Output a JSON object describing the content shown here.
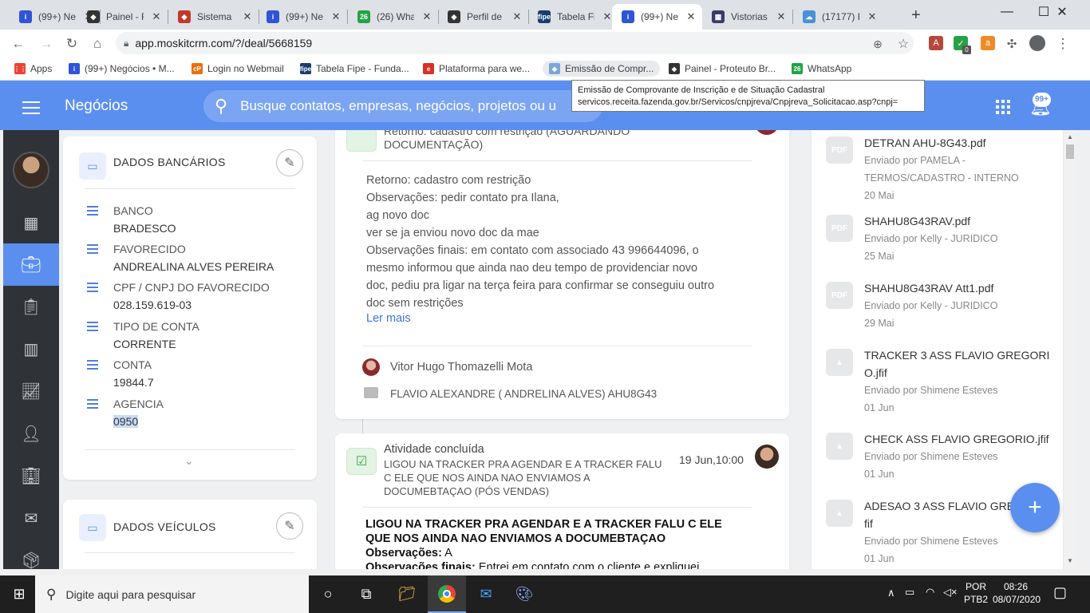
{
  "browser": {
    "tabs": [
      {
        "title": "(99+) Ne",
        "fav": "i",
        "color": "#2f54d6",
        "active": false
      },
      {
        "title": "Painel - F",
        "fav": "◆",
        "color": "#333333",
        "active": false
      },
      {
        "title": "Sistema |",
        "fav": "◆",
        "color": "#c0392b",
        "active": false
      },
      {
        "title": "(99+) Ne",
        "fav": "i",
        "color": "#2f54d6",
        "active": false
      },
      {
        "title": "(26) Wha",
        "fav": "26",
        "color": "#25a244",
        "active": false
      },
      {
        "title": "Perfil de",
        "fav": "◆",
        "color": "#333333",
        "active": false
      },
      {
        "title": "Tabela Fi",
        "fav": "fipe",
        "color": "#1b3b6f",
        "active": false
      },
      {
        "title": "(99+) Ne",
        "fav": "i",
        "color": "#2f54d6",
        "active": true
      },
      {
        "title": "Vistorias",
        "fav": "▦",
        "color": "#3a3a6a",
        "active": false
      },
      {
        "title": "(17177) F",
        "fav": "☁",
        "color": "#4a90d9",
        "active": false
      }
    ],
    "new_tab": "+",
    "url": "app.moskitcrm.com/?/deal/5668159",
    "bookmarks": [
      {
        "label": "Apps",
        "color": "#ea4335",
        "icon": "⋮⋮"
      },
      {
        "label": "(99+) Negócios • M...",
        "color": "#2f54d6",
        "icon": "i"
      },
      {
        "label": "Login no Webmail",
        "color": "#e8710a",
        "icon": "cP"
      },
      {
        "label": "Tabela Fipe - Funda...",
        "color": "#1b3b6f",
        "icon": "fipe"
      },
      {
        "label": "Plataforma para we...",
        "color": "#d93025",
        "icon": "e"
      },
      {
        "label": "Emissão de Compr...",
        "color": "#7aa7d8",
        "icon": "◆"
      },
      {
        "label": "Painel - Proteuto Br...",
        "color": "#333333",
        "icon": "◆"
      },
      {
        "label": "WhatsApp",
        "color": "#25a244",
        "icon": "26"
      }
    ],
    "extension_badge": "0"
  },
  "tooltip": {
    "line1": "Emissão de Comprovante de Inscrição e de Situação Cadastral",
    "line2": "servicos.receita.fazenda.gov.br/Servicos/cnpjreva/Cnpjreva_Solicitacao.asp?cnpj="
  },
  "header": {
    "title": "Negócios",
    "search_placeholder": "Busque contatos, empresas, negócios, projetos ou u",
    "notif_badge": "99+"
  },
  "bank": {
    "title": "DADOS BANCÁRIOS",
    "fields": [
      {
        "label": "BANCO",
        "value": "BRADESCO"
      },
      {
        "label": "FAVORECIDO",
        "value": "ANDREALINA ALVES PEREIRA"
      },
      {
        "label": "CPF / CNPJ  DO  FAVORECIDO",
        "value": "028.159.619-03"
      },
      {
        "label": "TIPO DE CONTA",
        "value": "CORRENTE"
      },
      {
        "label": "CONTA",
        "value": "19844.7"
      },
      {
        "label": "AGENCIA",
        "value": "0950"
      }
    ]
  },
  "vehicles": {
    "title": "DADOS VEÍCULOS"
  },
  "activity1": {
    "header_line1": "Retorno: cadastro com restrição (AGUARDANDO",
    "header_line2": "DOCUMENTAÇÃO)",
    "body": [
      "Retorno: cadastro com restrição",
      "Observações: pedir contato pra Ilana,",
      "ag novo doc",
      "ver se ja enviou novo doc da mae",
      "Observações finais: em contato com associado 43 996644096, o",
      "mesmo informou que ainda nao deu tempo de providenciar novo",
      "doc, pediu pra ligar na terça feira para confirmar se conseguiu outro",
      "doc sem restrições"
    ],
    "more": "Ler mais",
    "user": "Vitor Hugo Thomazelli Mota",
    "deal": "FLAVIO ALEXANDRE ( ANDRELINA ALVES) AHU8G43"
  },
  "activity2": {
    "status": "Atividade concluída",
    "subject": [
      "LIGOU NA TRACKER PRA AGENDAR E A TRACKER FALU",
      "C ELE QUE NOS AINDA NAO ENVIAMOS A",
      "DOCUMEBTAÇAO (PÓS VENDAS)"
    ],
    "date": "19 Jun,10:00",
    "body_bold": [
      "LIGOU NA TRACKER PRA AGENDAR E A TRACKER FALU C ELE",
      "QUE NOS AINDA NAO ENVIAMOS A DOCUMEBTAÇAO"
    ],
    "obs_label": "Observações:",
    "obs_value": " A",
    "obs_final_label": "Observações finais:",
    "obs_final_value": " Entrei em contato com o cliente e expliquei"
  },
  "files": [
    {
      "name": "DETRAN AHU-8G43.pdf",
      "sub1": "Enviado por PAMELA -",
      "sub2": "TERMOS/CADASTRO - INTERNO",
      "date": "20 Mai",
      "kind": "PDF"
    },
    {
      "name": "SHAHU8G43RAV.pdf",
      "sub1": "Enviado por Kelly - JURIDICO",
      "sub2": "",
      "date": "25 Mai",
      "kind": "PDF"
    },
    {
      "name": "SHAHU8G43RAV Att1.pdf",
      "sub1": "Enviado por Kelly - JURIDICO",
      "sub2": "",
      "date": "29 Mai",
      "kind": "PDF"
    },
    {
      "name": "TRACKER 3 ASS FLAVIO GREGORI",
      "name2": "O.jfif",
      "sub1": "Enviado por Shimene Esteves",
      "sub2": "",
      "date": "01 Jun",
      "kind": "IMG"
    },
    {
      "name": "CHECK ASS FLAVIO GREGORIO.jfif",
      "sub1": "Enviado por Shimene Esteves",
      "sub2": "",
      "date": "01 Jun",
      "kind": "IMG"
    },
    {
      "name": "ADESAO 3 ASS FLAVIO GREG",
      "name2": "fif",
      "sub1": "Enviado por Shimene Esteves",
      "sub2": "",
      "date": "01 Jun",
      "kind": "IMG"
    }
  ],
  "fab": "+",
  "taskbar": {
    "search_placeholder": "Digite aqui para pesquisar",
    "lang1": "POR",
    "lang2": "PTB2",
    "time": "08:26",
    "date": "08/07/2020"
  }
}
